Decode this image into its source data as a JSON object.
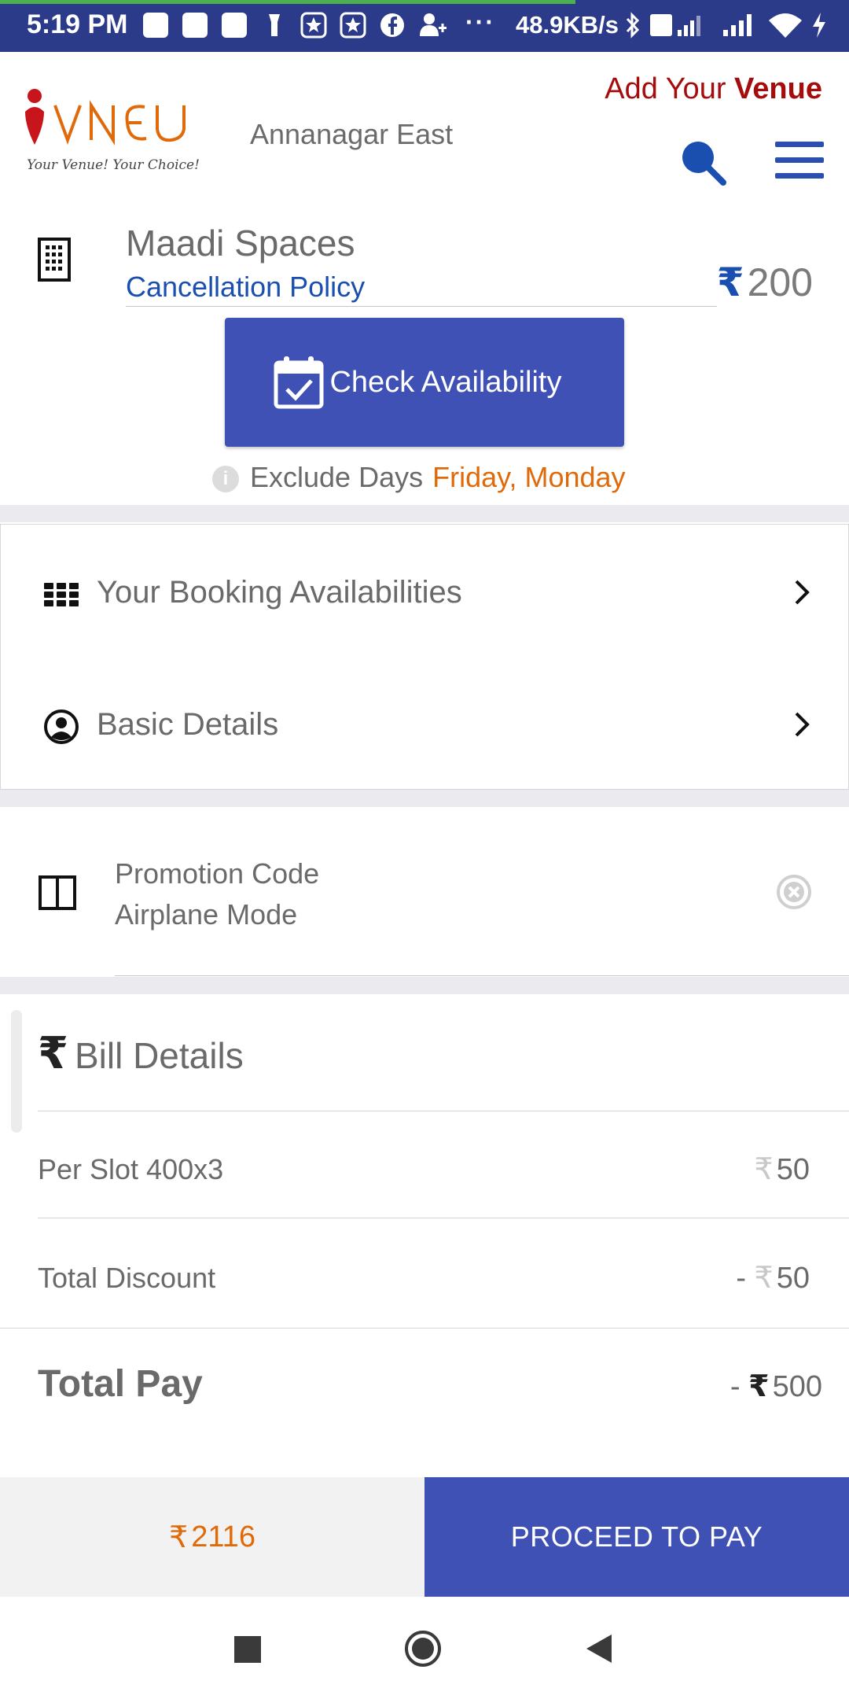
{
  "status_bar": {
    "time": "5:19 PM",
    "speed": "48.9KB/s",
    "dots": "···",
    "icons": [
      "message-icon",
      "message-icon",
      "message-icon",
      "torch-icon",
      "star-badge-icon",
      "star-badge-icon",
      "facebook-icon",
      "add-user-icon",
      "bluetooth-icon",
      "volte-icon",
      "signal-icon",
      "signal-icon",
      "wifi-icon",
      "charging-icon"
    ]
  },
  "header": {
    "logo_text": "iVNEU",
    "logo_tagline": "Your Venue! Your Choice!",
    "location": "Annanagar East",
    "add_venue_prefix": "Add Your ",
    "add_venue_bold": "Venue"
  },
  "venue": {
    "name": "Maadi Spaces",
    "cancellation_link": "Cancellation Policy",
    "price_symbol": "₹",
    "price": "200"
  },
  "check_availability": {
    "label": "Check Availability"
  },
  "exclude": {
    "label": "Exclude Days",
    "days": "Friday, Monday",
    "info": "i"
  },
  "options": [
    {
      "label": "Your Booking Availabilities"
    },
    {
      "label": "Basic Details"
    }
  ],
  "promo": {
    "title": "Promotion Code",
    "value": "Airplane Mode"
  },
  "bill": {
    "title": "Bill Details",
    "symbol": "₹",
    "rows": [
      {
        "label": "Per Slot 400x3",
        "prefix": "",
        "value": "50"
      },
      {
        "label": "Total Discount",
        "prefix": "- ",
        "value": "50"
      }
    ],
    "total": {
      "label": "Total Pay",
      "prefix": "- ",
      "value": "500"
    }
  },
  "footer": {
    "amount_symbol": "₹",
    "amount": "2116",
    "pay_label": "PROCEED TO PAY"
  },
  "colors": {
    "primary": "#3f51b5",
    "accent_orange": "#e06a0a",
    "link_blue": "#1a4fb0",
    "brand_red": "#a50d0d",
    "status_bar": "#2c3a8a"
  }
}
